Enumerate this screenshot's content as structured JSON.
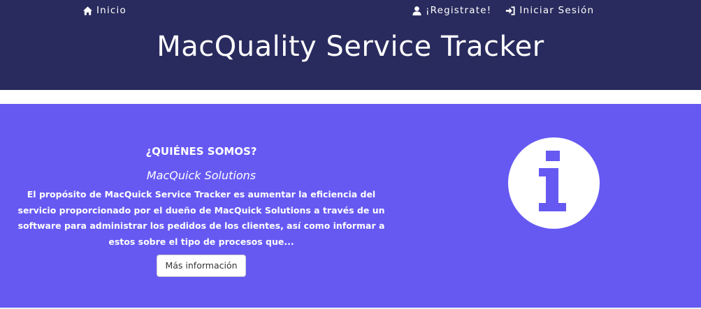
{
  "nav": {
    "home": {
      "label": "Inicio",
      "icon": "home-icon"
    },
    "register": {
      "label": "¡Registrate!",
      "icon": "user-icon"
    },
    "login": {
      "label": "Iniciar Sesión",
      "icon": "log-in-icon"
    }
  },
  "header": {
    "title": "MacQuality Service Tracker"
  },
  "about": {
    "heading": "¿QUIÉNES SOMOS?",
    "company": "MacQuick Solutions",
    "description": "El propósito de MacQuick Service Tracker es aumentar la eficiencia del servicio proporcionado por el dueño de MacQuick Solutions a través de un software para administrar los pedidos de los clientes, así como informar a estos sobre el tipo de procesos que...",
    "button_label": "Más información",
    "icon": "info-icon"
  },
  "colors": {
    "header_bg": "#292b5e",
    "section_bg": "#6659f2",
    "text": "#ffffff",
    "button_bg": "#ffffff"
  }
}
